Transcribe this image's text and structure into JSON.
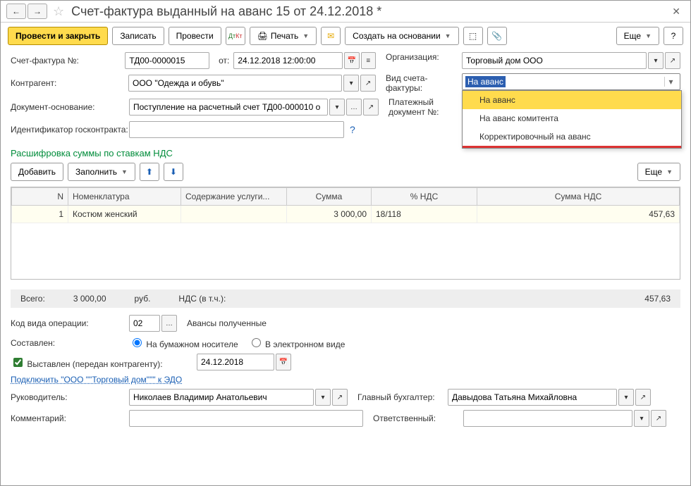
{
  "title": "Счет-фактура выданный на аванс 15 от 24.12.2018 *",
  "toolbar": {
    "post_close": "Провести и закрыть",
    "save": "Записать",
    "post": "Провести",
    "print": "Печать",
    "create_based": "Создать на основании",
    "more": "Еще"
  },
  "fields": {
    "invoice_no_label": "Счет-фактура №:",
    "invoice_no": "ТД00-0000015",
    "from_label": "от:",
    "date": "24.12.2018 12:00:00",
    "org_label": "Организация:",
    "org": "Торговый дом ООО",
    "counterparty_label": "Контрагент:",
    "counterparty": "ООО \"Одежда и обувь\"",
    "invoice_kind_label": "Вид счета-фактуры:",
    "invoice_kind_value": "На аванс",
    "basis_label": "Документ-основание:",
    "basis": "Поступление на расчетный счет ТД00-000010 о",
    "pay_doc_label": "Платежный документ №:",
    "contract_id_label": "Идентификатор госконтракта:"
  },
  "dropdown_options": [
    "На аванс",
    "На аванс комитента",
    "Корректировочный на аванс"
  ],
  "section_vat": "Расшифровка суммы по ставкам НДС",
  "table_toolbar": {
    "add": "Добавить",
    "fill": "Заполнить",
    "more": "Еще"
  },
  "table": {
    "headers": {
      "n": "N",
      "nomen": "Номенклатура",
      "service": "Содержание услуги...",
      "sum": "Сумма",
      "vat_pct": "% НДС",
      "vat_sum": "Сумма НДС"
    },
    "rows": [
      {
        "n": "1",
        "nomen": "Костюм женский",
        "service": "",
        "sum": "3 000,00",
        "vat_pct": "18/118",
        "vat_sum": "457,63"
      }
    ]
  },
  "totals": {
    "label": "Всего:",
    "sum": "3 000,00",
    "currency": "руб.",
    "vat_label": "НДС (в т.ч.):",
    "vat_sum": "457,63"
  },
  "footer": {
    "op_code_label": "Код вида операции:",
    "op_code": "02",
    "op_code_text": "Авансы полученные",
    "composed_label": "Составлен:",
    "radio_paper": "На бумажном носителе",
    "radio_electronic": "В электронном виде",
    "issued_label": "Выставлен (передан контрагенту):",
    "issued_date": "24.12.2018",
    "edo_link": "Подключить \"ООО \"\"Торговый дом\"\"\" к ЭДО",
    "director_label": "Руководитель:",
    "director": "Николаев Владимир Анатольевич",
    "accountant_label": "Главный бухгалтер:",
    "accountant": "Давыдова Татьяна Михайловна",
    "comment_label": "Комментарий:",
    "responsible_label": "Ответственный:"
  }
}
